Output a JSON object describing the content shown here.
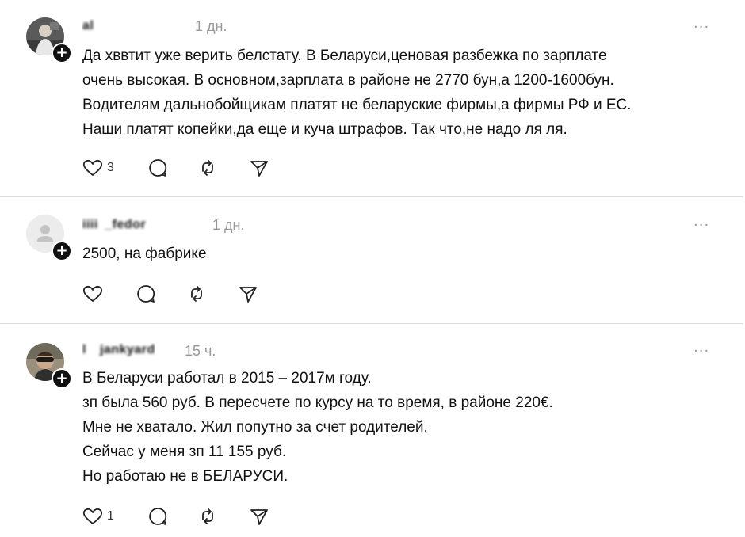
{
  "posts": [
    {
      "username": "al       ",
      "time": "1 дн.",
      "text": "Да хввтит уже верить белстату. В Беларуси,ценовая разбежка по зарплате\nочень высокая. В основном,зарплата в районе не 2770 бун,а 1200-1600бун.\nВодителям дальнобойщикам платят не беларуские фирмы,а фирмы РФ и ЕС.\nНаши платят копейки,да еще и куча штрафов. Так что,не надо ля ля.",
      "likes": "3",
      "avatar": "photo-person"
    },
    {
      "username": "iiii _fedor  ",
      "time": "1 дн.",
      "text": "2500, на фабрике",
      "likes": "",
      "avatar": "default-avatar"
    },
    {
      "username": "l  jankyard",
      "time": "15 ч.",
      "text": "В Беларуси работал в 2015 – 2017м году.\nзп была 560 руб. В пересчете по курсу на то время, в районе 220€.\nМне не хватало. Жил попутно за счет родителей.\nСейчас у меня зп 11 155 руб.\nНо работаю не в БЕЛАРУСИ.",
      "likes": "1",
      "avatar": "photo-person-sunglasses"
    }
  ],
  "more_label": "···",
  "icons": [
    "heart-icon",
    "comment-icon",
    "repost-icon",
    "share-icon",
    "plus-icon",
    "more-icon"
  ]
}
